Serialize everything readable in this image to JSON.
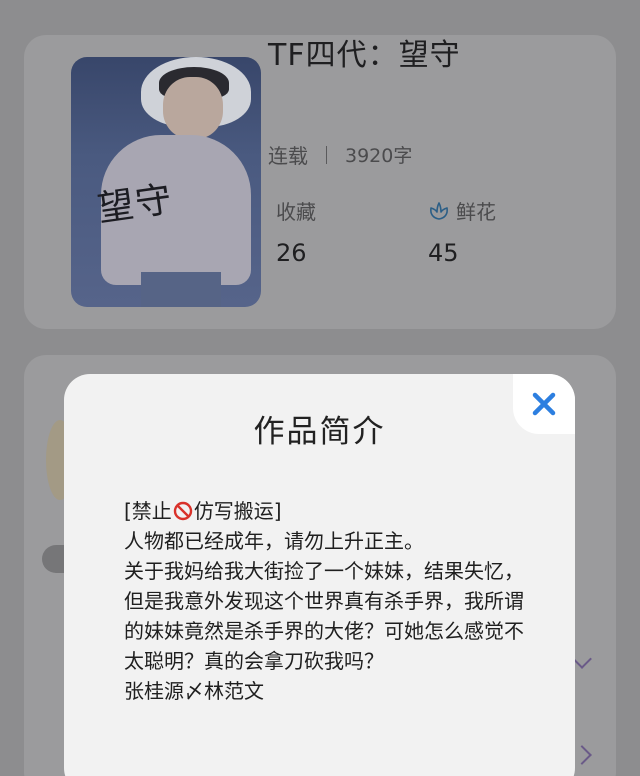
{
  "book": {
    "title": "TF四代：望守",
    "cover_text": "望守",
    "status": "连载",
    "word_count": "3920字",
    "favorites_label": "收藏",
    "favorites_value": "26",
    "flowers_label": "鲜花",
    "flowers_value": "45",
    "flower_icon": "flower-icon"
  },
  "modal": {
    "title": "作品简介",
    "close_icon": "close-icon",
    "intro_prefix": "[禁止",
    "intro_prefix_icon": "prohibited-icon",
    "intro_prefix_rest": "仿写搬运]",
    "intro_lines": [
      "人物都已经成年，请勿上升正主。",
      "关于我妈给我大街捡了一个妹妹，结果失忆，但是我意外发现这个世界真有杀手界，我所谓的妹妹竟然是杀手界的大佬？可她怎么感觉不太聪明？真的会拿刀砍我吗？",
      "张桂源〆林范文"
    ]
  },
  "colors": {
    "overlay": "#8d8d8f",
    "accent_blue": "#2d7fe0",
    "modal_bg": "#f2f2f2"
  }
}
